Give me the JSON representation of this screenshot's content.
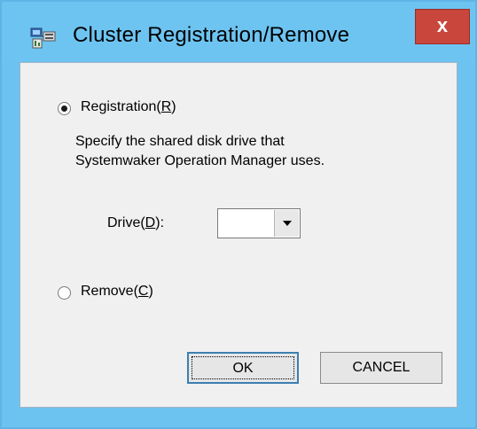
{
  "window": {
    "title": "Cluster Registration/Remove",
    "close_label": "x"
  },
  "registration": {
    "label_prefix": "Registration(",
    "mnemonic": "R",
    "label_suffix": ")",
    "selected": true,
    "description_line1": "Specify the shared disk drive that",
    "description_line2": "Systemwaker Operation Manager uses."
  },
  "drive": {
    "label_prefix": "Drive(",
    "mnemonic": "D",
    "label_suffix": "):",
    "value": ""
  },
  "remove": {
    "label_prefix": "Remove(",
    "mnemonic": "C",
    "label_suffix": ")",
    "selected": false
  },
  "buttons": {
    "ok": "OK",
    "cancel": "CANCEL"
  },
  "icons": {
    "app": "cluster-config-icon",
    "combo_arrow": "chevron-down-icon"
  }
}
